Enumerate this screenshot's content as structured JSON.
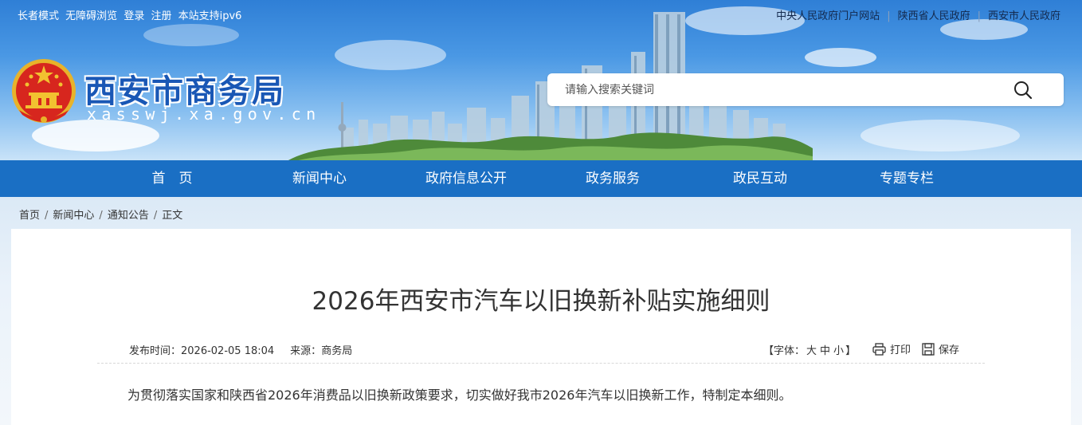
{
  "topbar": {
    "left_links": [
      "长者模式",
      "无障碍浏览",
      "登录",
      "注册",
      "本站支持ipv6"
    ],
    "right_links": [
      "中央人民政府门户网站",
      "陕西省人民政府",
      "西安市人民政府"
    ]
  },
  "site": {
    "title": "西安市商务局",
    "domain": "xasswj.xa.gov.cn"
  },
  "search": {
    "placeholder": "请输入搜索关键词",
    "icon": "search-icon"
  },
  "nav": {
    "items": [
      "首　页",
      "新闻中心",
      "政府信息公开",
      "政务服务",
      "政民互动",
      "专题专栏"
    ]
  },
  "breadcrumb": {
    "items": [
      "首页",
      "新闻中心",
      "通知公告",
      "正文"
    ],
    "separator": "/"
  },
  "article": {
    "title": "2026年西安市汽车以旧换新补贴实施细则",
    "publish_label": "发布时间：",
    "publish_time": "2026-02-05 18:04",
    "source_label": "来源：",
    "source": "商务局",
    "font_size_prefix": "【字体：",
    "font_sizes": [
      "大",
      "中",
      "小"
    ],
    "font_size_suffix": "】",
    "print_label": "打印",
    "save_label": "保存",
    "first_paragraph": "为贯彻落实国家和陕西省2026年消费品以旧换新政策要求，切实做好我市2026年汽车以旧换新工作，特制定本细则。"
  },
  "colors": {
    "nav_bg": "#1a6fc4",
    "title_blue": "#1957b5",
    "emblem_red": "#d7261e",
    "emblem_gold": "#f2c230"
  },
  "icons": {
    "print": "printer-icon",
    "save": "save-icon",
    "emblem": "national-emblem"
  }
}
